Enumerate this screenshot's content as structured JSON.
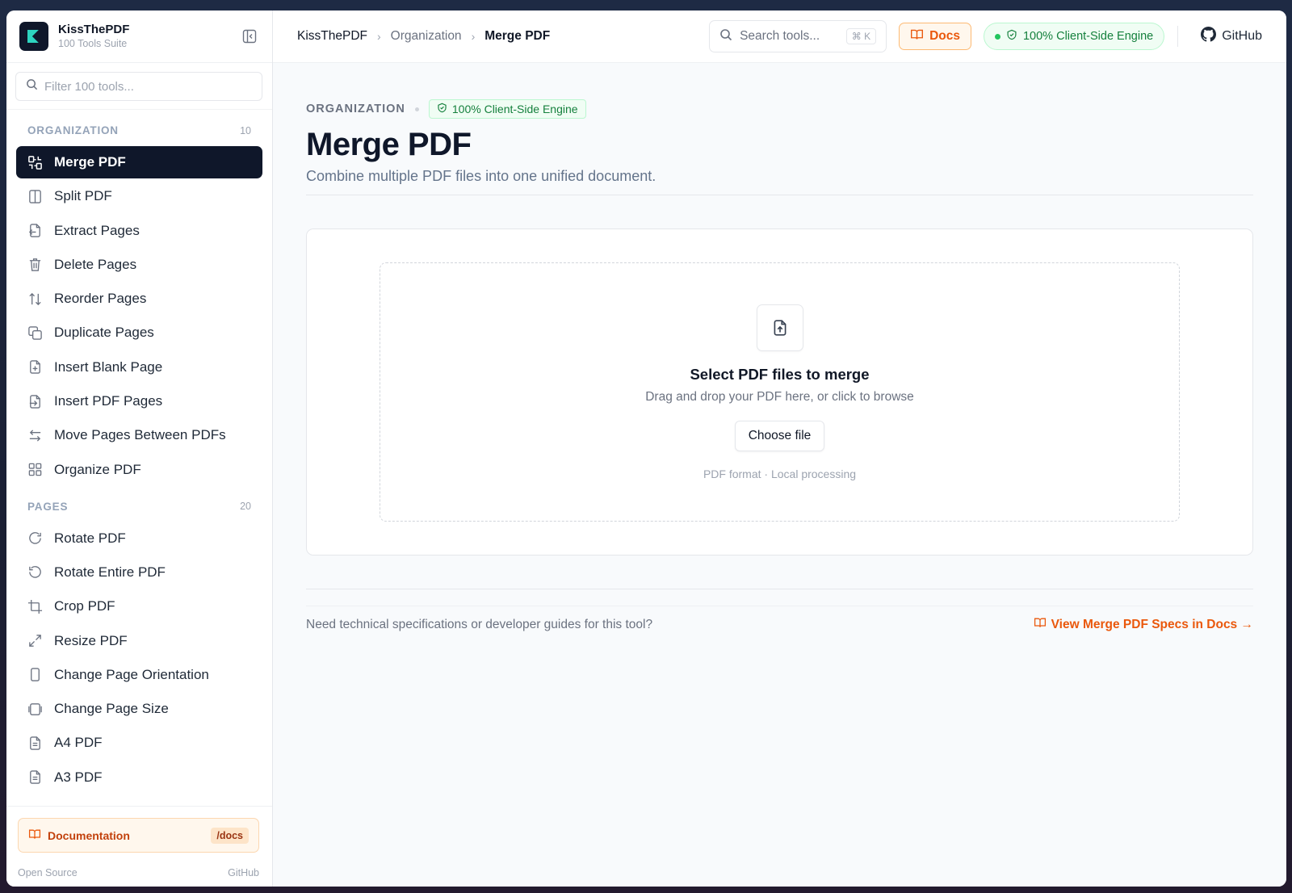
{
  "brand": {
    "title": "KissThePDF",
    "subtitle": "100 Tools Suite"
  },
  "sidebar": {
    "filter_placeholder": "Filter 100 tools...",
    "sections": [
      {
        "title": "ORGANIZATION",
        "count": "10"
      },
      {
        "title": "PAGES",
        "count": "20"
      }
    ],
    "organization_items": [
      {
        "label": "Merge PDF",
        "icon": "merge-icon",
        "active": true
      },
      {
        "label": "Split PDF",
        "icon": "split-icon"
      },
      {
        "label": "Extract Pages",
        "icon": "extract-icon"
      },
      {
        "label": "Delete Pages",
        "icon": "trash-icon"
      },
      {
        "label": "Reorder Pages",
        "icon": "reorder-icon"
      },
      {
        "label": "Duplicate Pages",
        "icon": "copy-icon"
      },
      {
        "label": "Insert Blank Page",
        "icon": "file-plus-icon"
      },
      {
        "label": "Insert PDF Pages",
        "icon": "file-import-icon"
      },
      {
        "label": "Move Pages Between PDFs",
        "icon": "swap-icon"
      },
      {
        "label": "Organize PDF",
        "icon": "grid-icon"
      }
    ],
    "pages_items": [
      {
        "label": "Rotate PDF",
        "icon": "rotate-cw-icon"
      },
      {
        "label": "Rotate Entire PDF",
        "icon": "rotate-ccw-icon"
      },
      {
        "label": "Crop PDF",
        "icon": "crop-icon"
      },
      {
        "label": "Resize PDF",
        "icon": "resize-icon"
      },
      {
        "label": "Change Page Orientation",
        "icon": "portrait-icon"
      },
      {
        "label": "Change Page Size",
        "icon": "page-size-icon"
      },
      {
        "label": "A4 PDF",
        "icon": "file-text-icon"
      },
      {
        "label": "A3 PDF",
        "icon": "file-text-icon"
      }
    ],
    "footer": {
      "doc_label": "Documentation",
      "doc_pill": "/docs",
      "left_link": "Open Source",
      "right_link": "GitHub"
    }
  },
  "topbar": {
    "breadcrumbs": [
      "KissThePDF",
      "Organization",
      "Merge PDF"
    ],
    "search_placeholder": "Search tools...",
    "search_shortcut": "⌘ K",
    "docs_label": "Docs",
    "engine_label": "100% Client-Side Engine",
    "github_label": "GitHub"
  },
  "page": {
    "category": "ORGANIZATION",
    "badge": "100% Client-Side Engine",
    "title": "Merge PDF",
    "subtitle": "Combine multiple PDF files into one unified document.",
    "dropzone": {
      "title": "Select PDF files to merge",
      "subtitle": "Drag and drop your PDF here, or click to browse",
      "button": "Choose file",
      "meta": "PDF format · Local processing"
    },
    "specs_question": "Need technical specifications or developer guides for this tool?",
    "specs_link": "View Merge PDF Specs in Docs →"
  },
  "colors": {
    "accent": "#ea580c",
    "active_bg": "#0f172a",
    "engine_green": "#15803d"
  }
}
